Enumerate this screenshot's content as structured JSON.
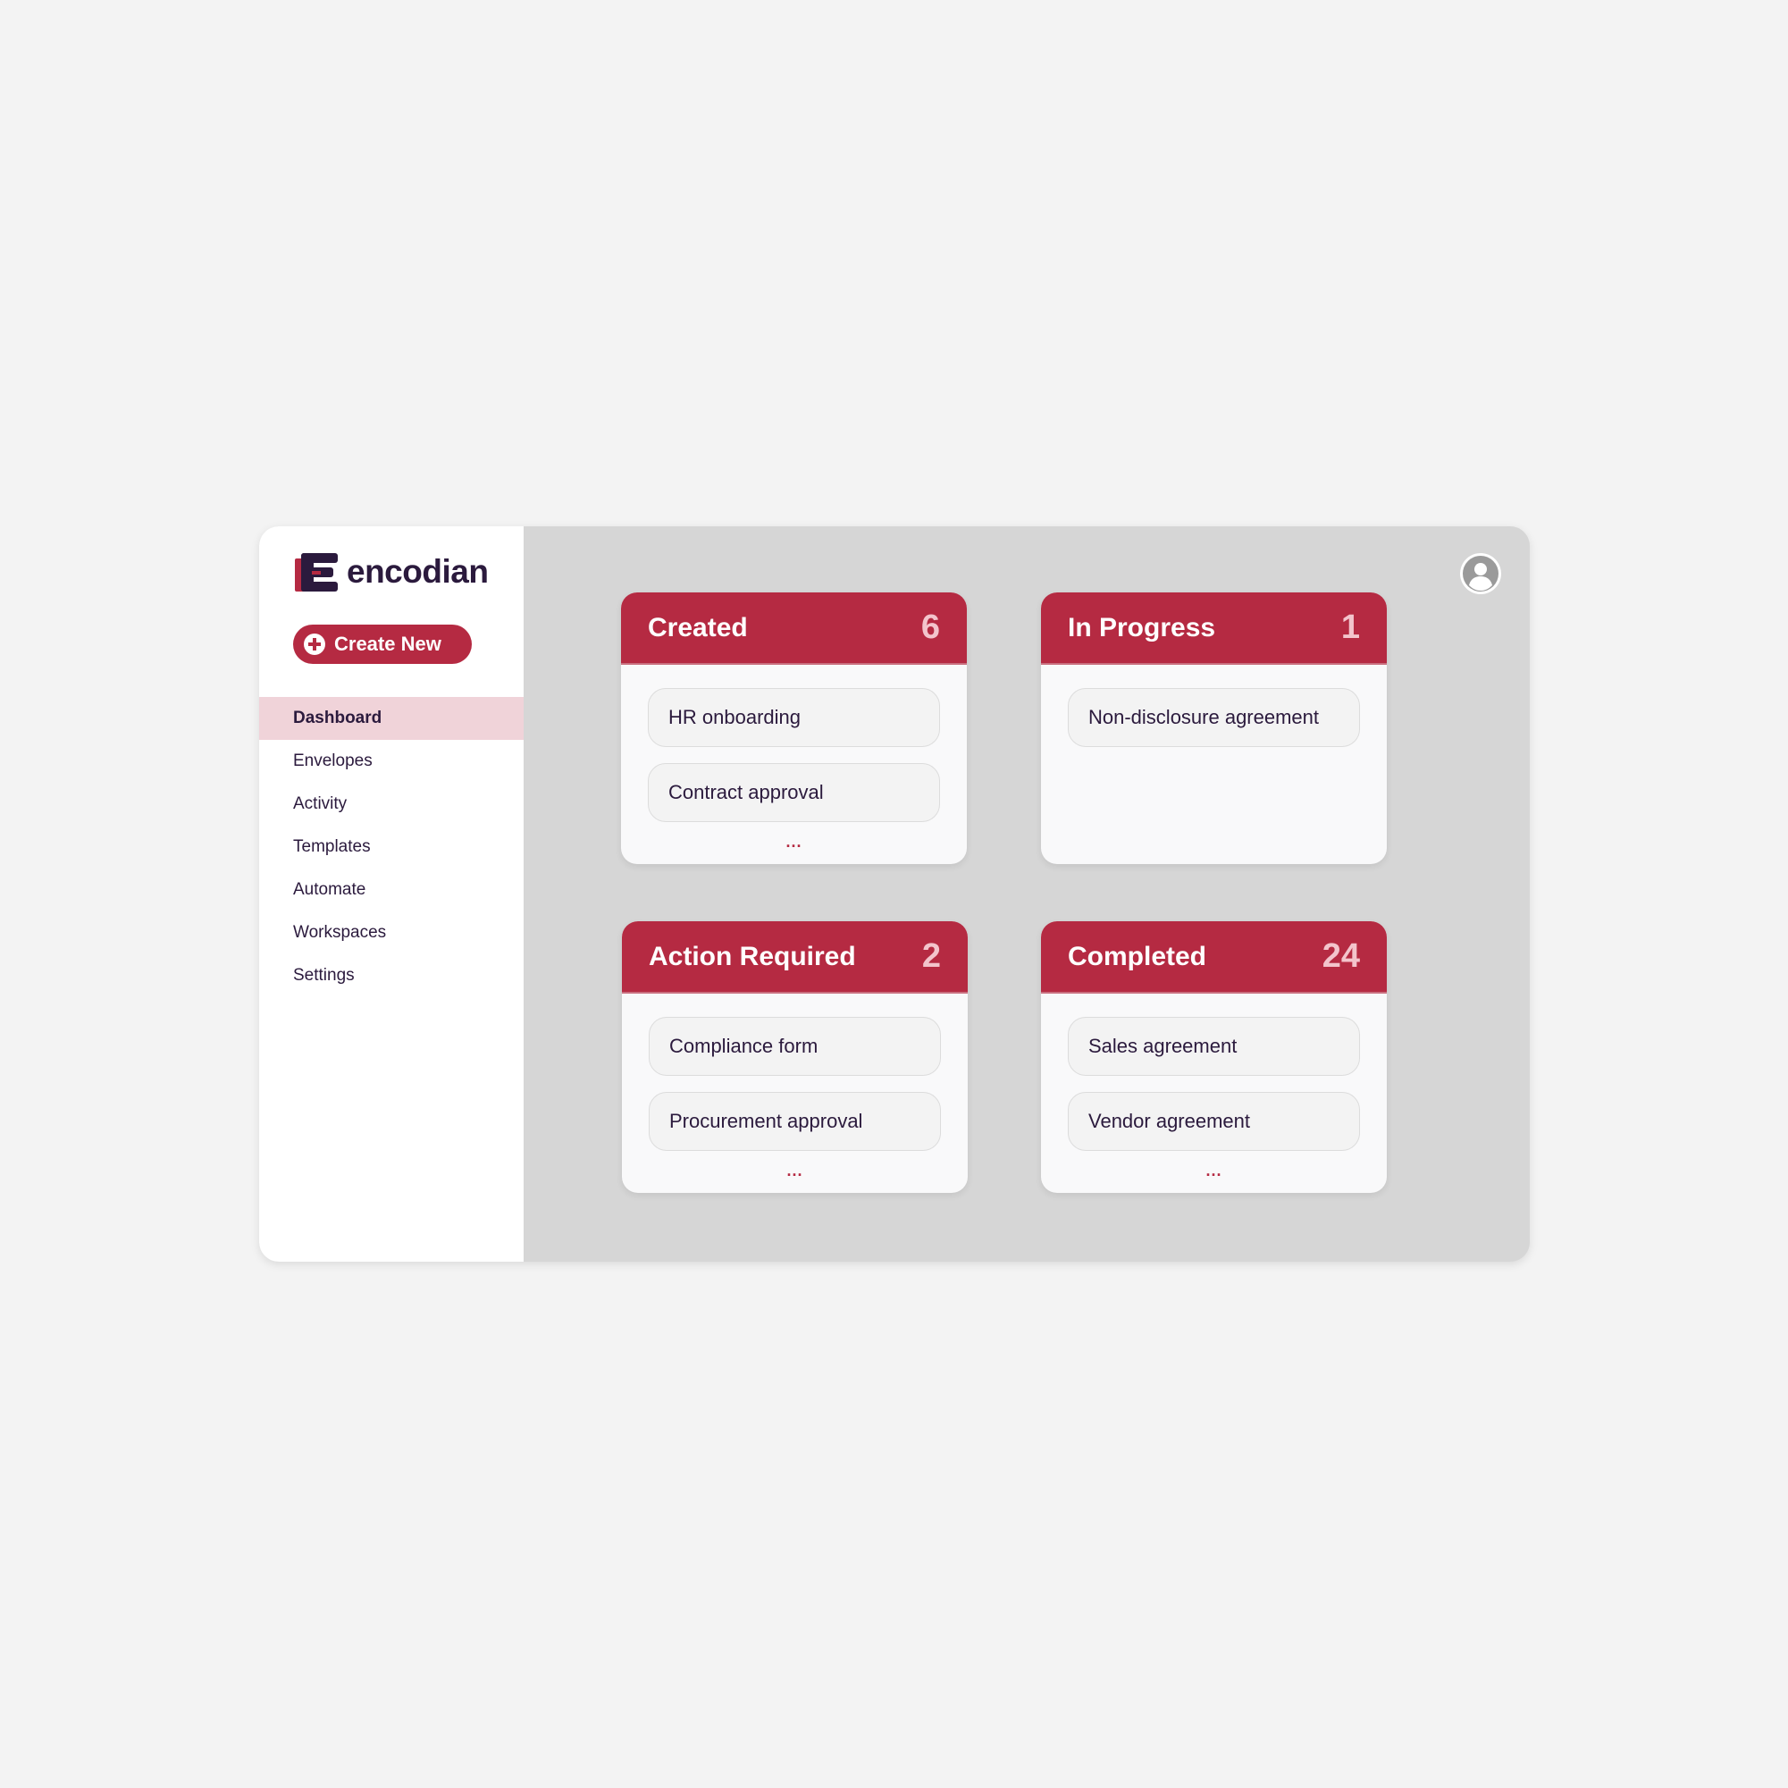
{
  "app": {
    "logo_text": "encodian"
  },
  "create_button": {
    "label": "Create New"
  },
  "nav": {
    "items": [
      {
        "label": "Dashboard",
        "active": true
      },
      {
        "label": "Envelopes",
        "active": false
      },
      {
        "label": "Activity",
        "active": false
      },
      {
        "label": "Templates",
        "active": false
      },
      {
        "label": "Automate",
        "active": false
      },
      {
        "label": "Workspaces",
        "active": false
      },
      {
        "label": "Settings",
        "active": false
      }
    ]
  },
  "cards": [
    {
      "title": "Created",
      "count": "6",
      "items": [
        "HR onboarding",
        "Contract approval"
      ],
      "more": "..."
    },
    {
      "title": "In Progress",
      "count": "1",
      "items": [
        "Non-disclosure agreement"
      ],
      "more": ""
    },
    {
      "title": "Action Required",
      "count": "2",
      "items": [
        "Compliance form",
        "Procurement approval"
      ],
      "more": "..."
    },
    {
      "title": "Completed",
      "count": "24",
      "items": [
        "Sales agreement",
        "Vendor agreement"
      ],
      "more": "..."
    }
  ],
  "colors": {
    "brand": "#b52a42",
    "brand_dark": "#2b1a3d",
    "active_nav_bg": "#f0d3d9",
    "content_bg": "#d6d6d6",
    "page_bg": "#f3f3f3"
  },
  "icons": {
    "logo": "encodian-logo-icon",
    "create": "plus-circle-icon",
    "user": "user-avatar-icon"
  }
}
